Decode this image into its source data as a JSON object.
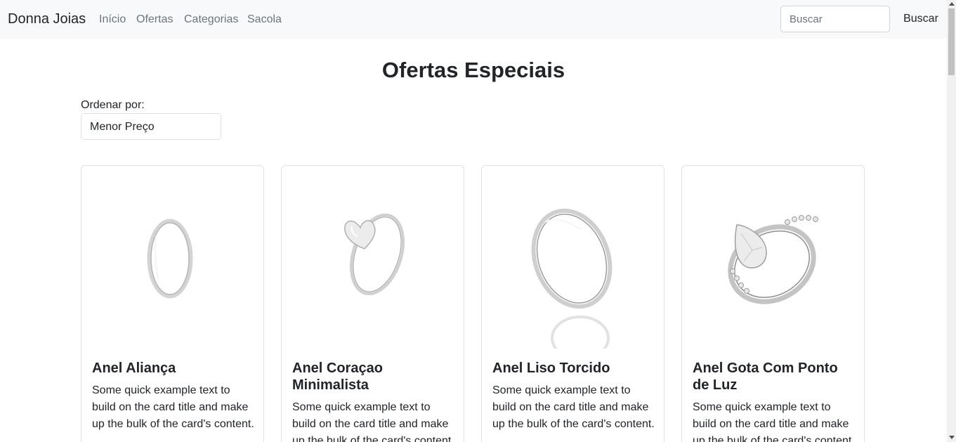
{
  "navbar": {
    "brand": "Donna Joias",
    "links": [
      "Início",
      "Ofertas",
      "Categorias",
      "Sacola"
    ],
    "search_placeholder": "Buscar",
    "search_button": "Buscar"
  },
  "main": {
    "title": "Ofertas Especiais",
    "sort_label": "Ordenar por:",
    "sort_value": "Menor Preço"
  },
  "products": [
    {
      "title": "Anel Aliança",
      "text": "Some quick example text to build on the card title and make up the bulk of the card's content.",
      "image": "plain-band-ring-icon"
    },
    {
      "title": "Anel Coraçao Minimalista",
      "text": "Some quick example text to build on the card title and make up the bulk of the card's content.",
      "image": "heart-ring-icon"
    },
    {
      "title": "Anel Liso Torcido",
      "text": "Some quick example text to build on the card title and make up the bulk of the card's content.",
      "image": "twisted-ring-icon"
    },
    {
      "title": "Anel Gota Com Ponto de Luz",
      "text": "Some quick example text to build on the card title and make up the bulk of the card's content.",
      "image": "teardrop-gem-ring-icon"
    }
  ],
  "colors": {
    "navbar_bg": "#f8f9fa",
    "text": "#212529",
    "muted": "#6c757d",
    "border": "#dee2e6",
    "silver": "#c8c8c8"
  }
}
